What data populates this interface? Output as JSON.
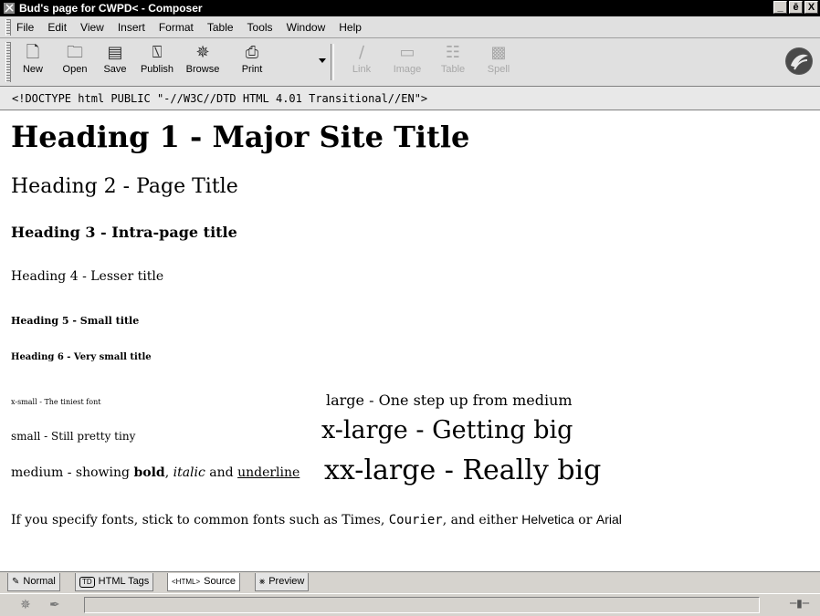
{
  "window": {
    "title": "Bud's page for CWPD< - Composer",
    "controls": [
      "_",
      "ē",
      "X"
    ]
  },
  "menubar": {
    "items": [
      "File",
      "Edit",
      "View",
      "Insert",
      "Format",
      "Table",
      "Tools",
      "Window",
      "Help"
    ]
  },
  "toolbar": {
    "buttons": [
      {
        "label": "New",
        "icon": "new-page-icon"
      },
      {
        "label": "Open",
        "icon": "folder-icon"
      },
      {
        "label": "Save",
        "icon": "floppy-icon"
      },
      {
        "label": "Publish",
        "icon": "publish-icon"
      },
      {
        "label": "Browse",
        "icon": "browse-icon"
      },
      {
        "label": "Print",
        "icon": "printer-icon"
      },
      {
        "label": "Link",
        "icon": "link-icon",
        "disabled": true
      },
      {
        "label": "Image",
        "icon": "image-icon",
        "disabled": true
      },
      {
        "label": "Table",
        "icon": "table-icon",
        "disabled": true
      },
      {
        "label": "Spell",
        "icon": "spell-icon",
        "disabled": true
      }
    ]
  },
  "doctype": "<!DOCTYPE html PUBLIC \"-//W3C//DTD HTML 4.01 Transitional//EN\">",
  "content": {
    "h1": "Heading 1 - Major Site Title",
    "h2": "Heading 2 - Page Title",
    "h3": "Heading 3 - Intra-page title",
    "h4": "Heading 4 - Lesser title",
    "h5": "Heading 5 - Small title",
    "h6": "Heading 6 - Very small title",
    "xsmall": "x-small - The tiniest font",
    "small": "small - Still pretty tiny",
    "medium_prefix": "medium - showing ",
    "medium_bold": "bold",
    "medium_sep1": ", ",
    "medium_italic": "italic",
    "medium_sep2": " and ",
    "medium_underline": "underline",
    "large": "large - One step up from medium",
    "xlarge": "x-large - Getting big",
    "xxlarge": "xx-large - Really big",
    "fonts_prefix": "If you specify fonts, stick to common fonts such as Times, ",
    "fonts_courier": "Courier",
    "fonts_mid": ", and either ",
    "fonts_helvetica": "Helvetica",
    "fonts_or": " or ",
    "fonts_arial": "Arial"
  },
  "tabs": [
    {
      "label": "Normal",
      "icon": "pencil-icon"
    },
    {
      "label": "HTML Tags",
      "icon": "td-tag-icon",
      "icon_text": "TD"
    },
    {
      "label": "Source",
      "icon": "html-tag-icon",
      "icon_text": "<HTML>",
      "active": true
    },
    {
      "label": "Preview",
      "icon": "preview-icon"
    }
  ]
}
